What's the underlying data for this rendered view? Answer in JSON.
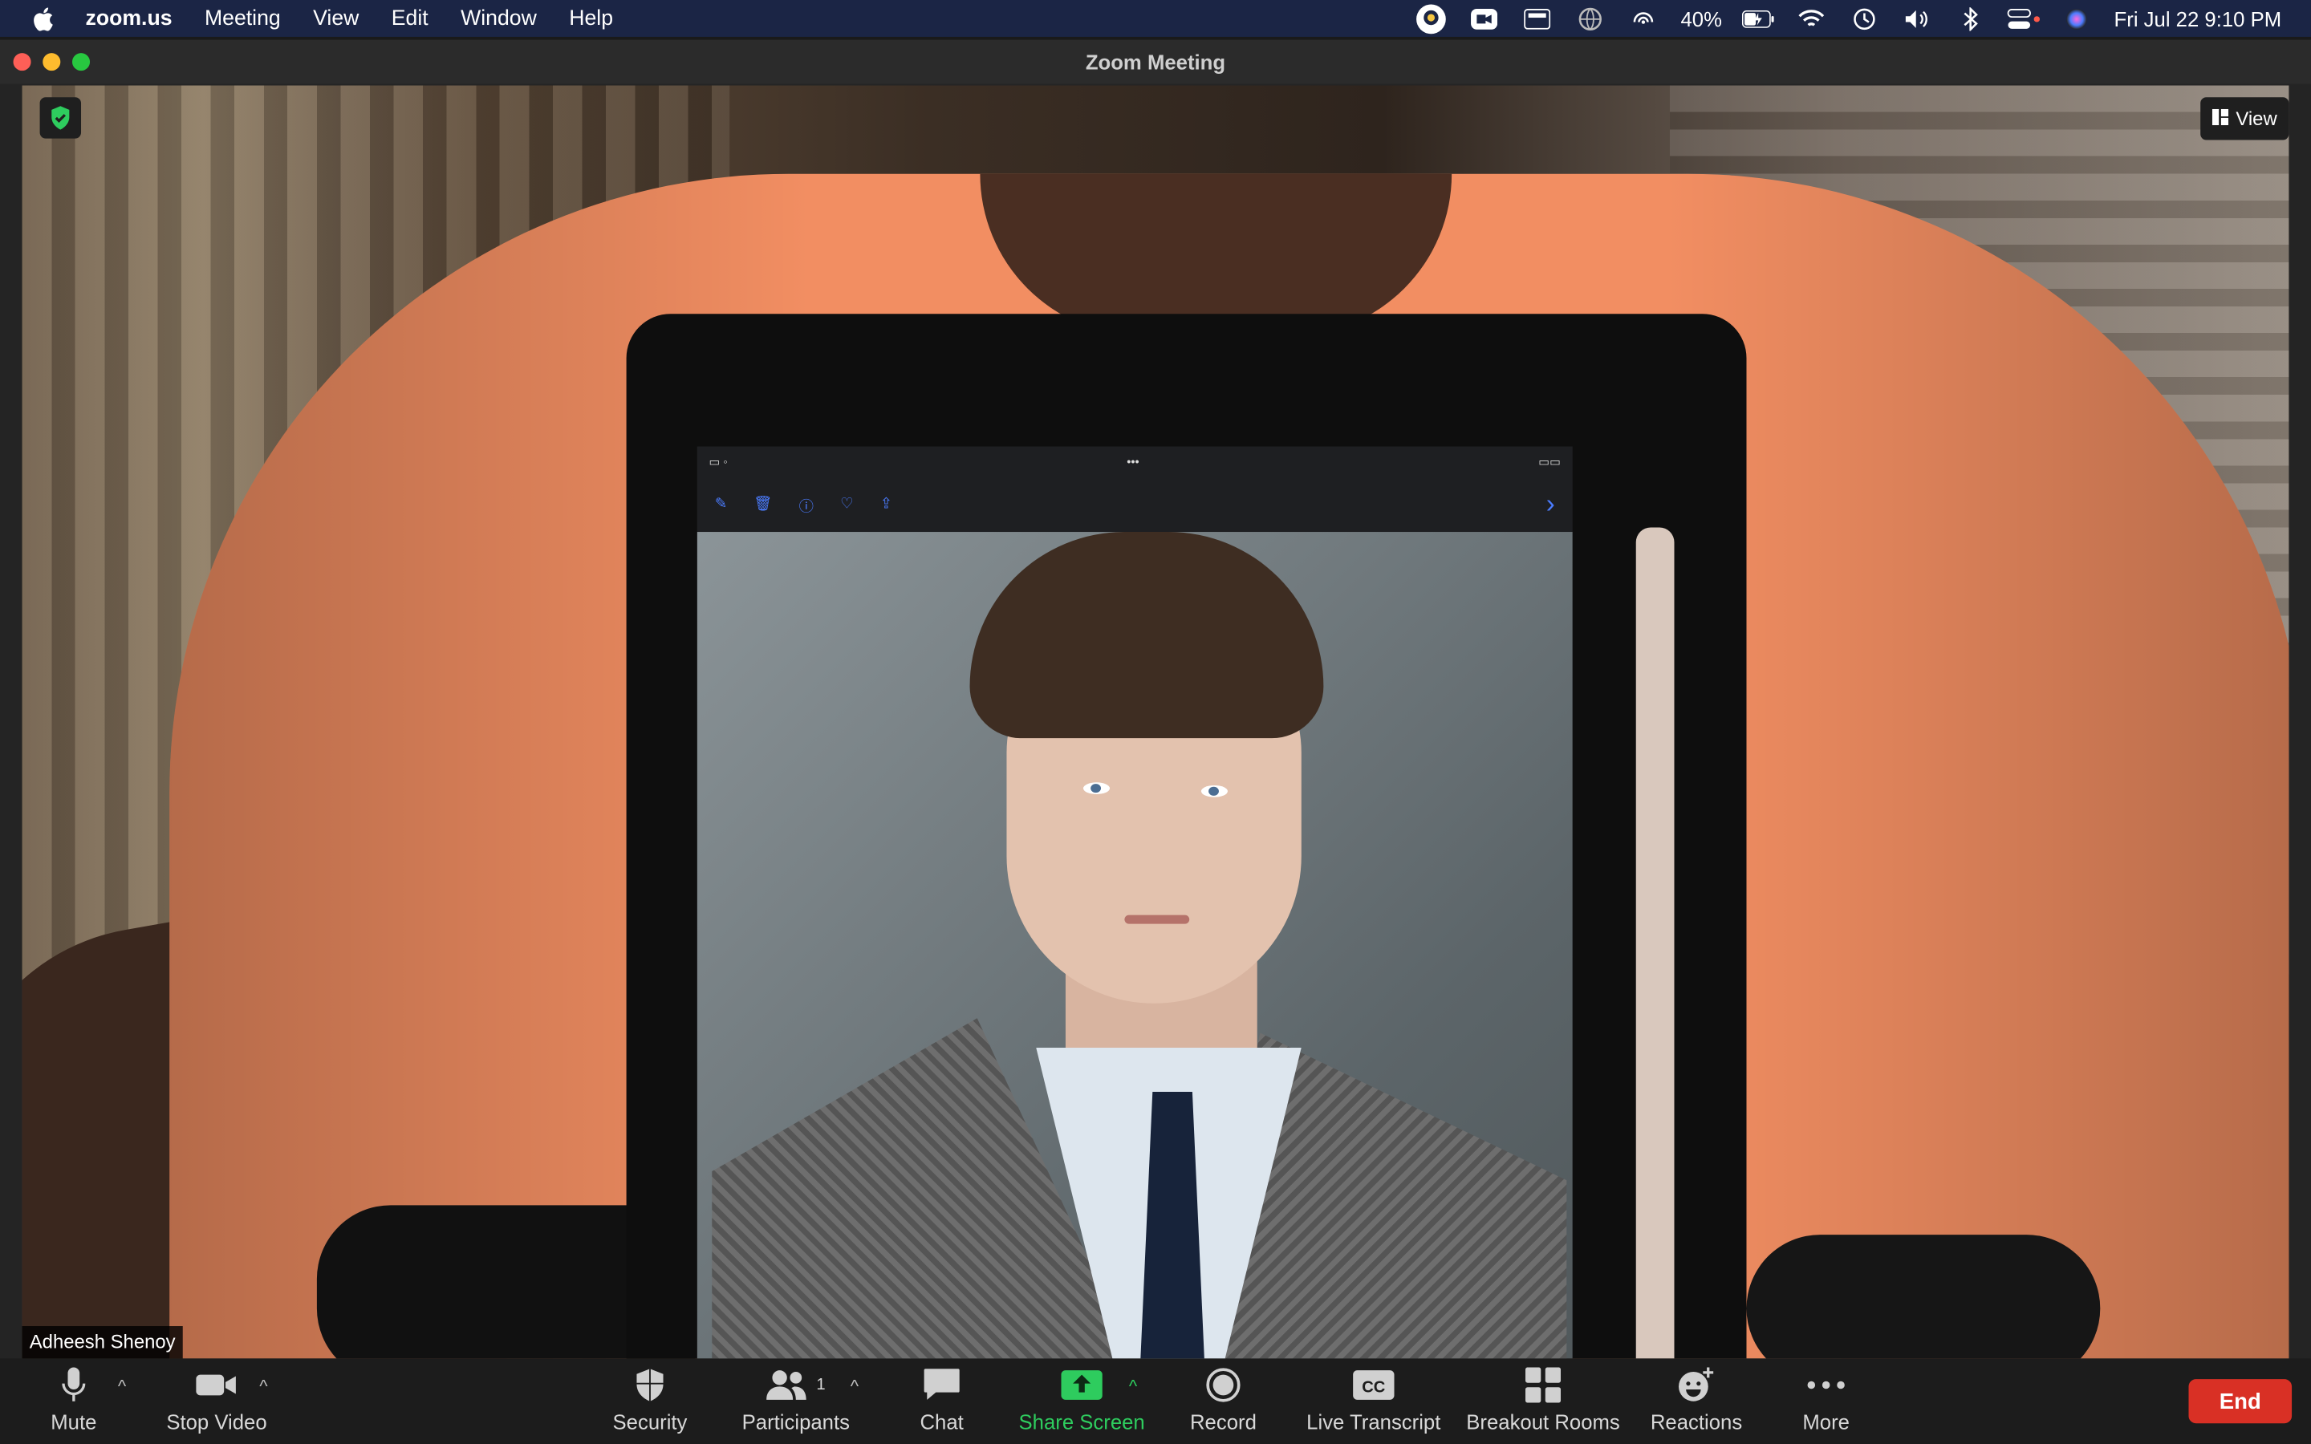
{
  "menubar": {
    "app_name": "zoom.us",
    "menus": [
      "Meeting",
      "View",
      "Edit",
      "Window",
      "Help"
    ],
    "battery": "40%",
    "datetime": "Fri Jul 22  9:10 PM"
  },
  "window": {
    "title": "Zoom Meeting",
    "view_label": "View",
    "participant_name": "Adheesh Shenoy"
  },
  "controls": {
    "mute": "Mute",
    "stop_video": "Stop Video",
    "security": "Security",
    "participants": "Participants",
    "participants_count": "1",
    "chat": "Chat",
    "share_screen": "Share Screen",
    "record": "Record",
    "live_transcript": "Live Transcript",
    "breakout_rooms": "Breakout Rooms",
    "reactions": "Reactions",
    "more": "More",
    "end": "End"
  },
  "colors": {
    "share_green": "#2ecc5e",
    "end_red": "#d93025",
    "menubar_bg": "#1b2545"
  }
}
